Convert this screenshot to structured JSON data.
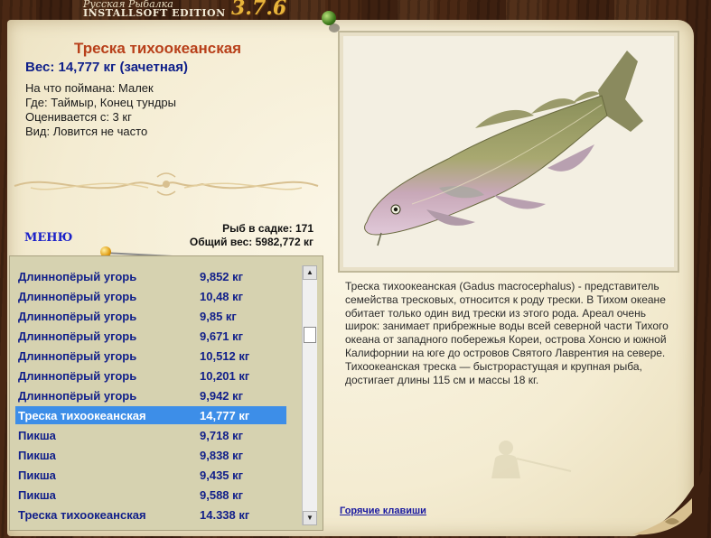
{
  "app": {
    "title_small": "Русская Рыбалка",
    "title_big": "INSTALLSOFT EDITION",
    "version": "3.7.6"
  },
  "catch": {
    "name": "Треска тихоокеанская",
    "weight_line": "Вес: 14,777 кг (зачетная)",
    "bait": "На что поймана: Малек",
    "place": "Где: Таймыр, Конец тундры",
    "value": "Оценивается с: 3 кг",
    "frequency": "Вид: Ловится не часто"
  },
  "menu_label": "МЕНЮ",
  "stats": {
    "fish_count": "Рыб в садке: 171",
    "total_weight": "Общий вес: 5982,772 кг"
  },
  "list": {
    "selected_index": 7,
    "rows": [
      {
        "name": "Длиннопёрый угорь",
        "weight": "9,852 кг"
      },
      {
        "name": "Длиннопёрый угорь",
        "weight": "10,48 кг"
      },
      {
        "name": "Длиннопёрый угорь",
        "weight": "9,85 кг"
      },
      {
        "name": "Длиннопёрый угорь",
        "weight": "9,671 кг"
      },
      {
        "name": "Длиннопёрый угорь",
        "weight": "10,512 кг"
      },
      {
        "name": "Длиннопёрый угорь",
        "weight": "10,201 кг"
      },
      {
        "name": "Длиннопёрый угорь",
        "weight": "9,942 кг"
      },
      {
        "name": "Треска тихоокеанская",
        "weight": "14,777 кг"
      },
      {
        "name": "Пикша",
        "weight": "9,718 кг"
      },
      {
        "name": "Пикша",
        "weight": "9,838 кг"
      },
      {
        "name": "Пикша",
        "weight": "9,435 кг"
      },
      {
        "name": "Пикша",
        "weight": "9,588 кг"
      },
      {
        "name": "Треска тихоокеанская",
        "weight": "14.338 кг"
      }
    ]
  },
  "description": "Треска тихоокеанская (Gadus macrocephalus) - представитель семейства тресковых, относится к роду трески. В Тихом океане обитает только один вид трески из этого рода. Ареал очень широк: занимает прибрежные воды всей северной части Тихого океана от западного побережья Кореи, острова Хонсю и южной Калифорнии на юге до островов Святого Лаврентия на севере. Тихоокеанская треска — быстрорастущая и крупная рыба, достигает длины 115 см и массы 18 кг.",
  "hotkeys_label": "Горячие клавиши",
  "colors": {
    "parchment": "#f4ecd2",
    "fish_name": "#b8401a",
    "weight": "#10208a",
    "list_bg": "#d6d2b0",
    "list_text": "#12208a",
    "selection": "#3d8ee8",
    "link": "#1a1aa0"
  }
}
